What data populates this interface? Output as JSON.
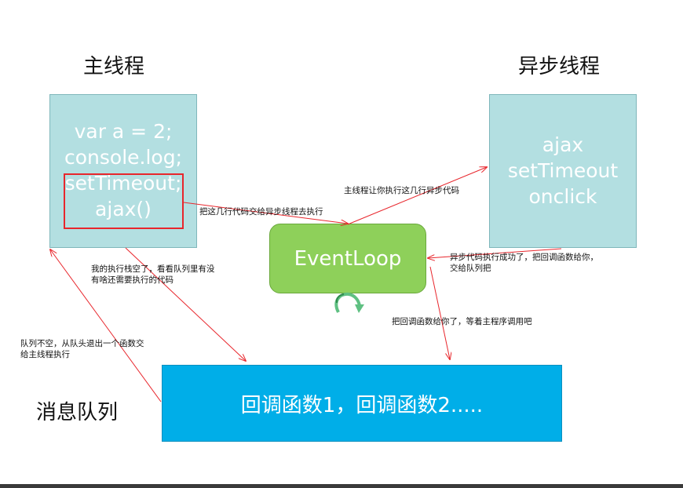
{
  "titles": {
    "main_thread": "主线程",
    "async_thread": "异步线程",
    "message_queue": "消息队列"
  },
  "main_thread_code": [
    "var a = 2;",
    "console.log;",
    "setTimeout;",
    "ajax()"
  ],
  "async_thread_items": [
    "ajax",
    "setTimeout",
    "onclick"
  ],
  "event_loop_label": "EventLoop",
  "queue_label": "回调函数1，回调函数2.....",
  "notes": {
    "hand_off": "把这几行代码交给异步线程去执行",
    "let_async_run": "主线程让你执行这几行异步代码",
    "async_done_line1": "异步代码执行成功了，把回调函数给你，",
    "async_done_line2": "交给队列把",
    "callback_to_queue": "把回调函数给你了，等着主程序调用吧",
    "stack_empty_line1": "我的执行栈空了，看看队列里有没",
    "stack_empty_line2": "有啥还需要执行的代码",
    "queue_not_empty_line1": "队列不空，从队头退出一个函数交",
    "queue_not_empty_line2": "给主线程执行"
  },
  "colors": {
    "thread_box": "#b3dfe1",
    "event_loop": "#8ed05a",
    "queue": "#00aee8",
    "arrow": "#e8262c",
    "highlight": "#e8262c"
  }
}
